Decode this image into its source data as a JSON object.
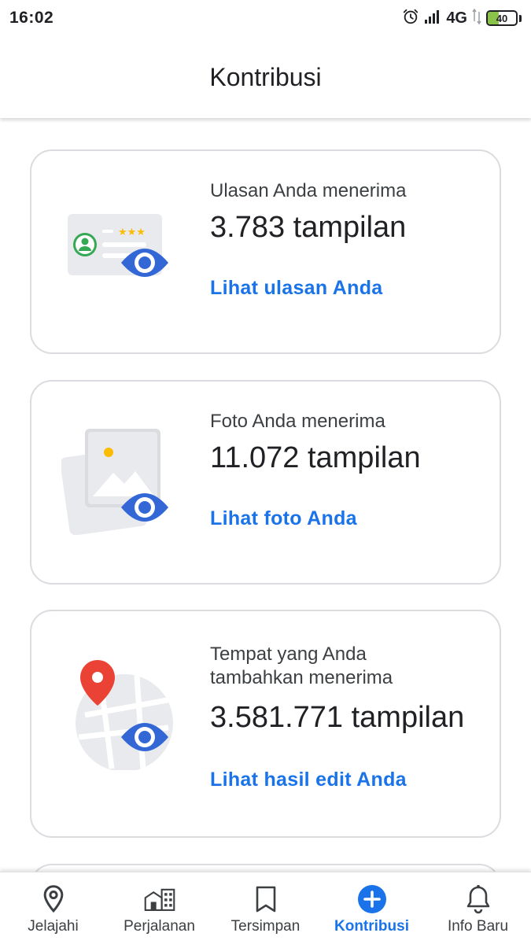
{
  "status_bar": {
    "time": "16:02",
    "network": "4G",
    "battery_level": "40",
    "battery_fill_percent": 40,
    "icons": [
      "alarm-icon",
      "signal-icon",
      "data-arrows-icon",
      "battery-icon"
    ]
  },
  "header": {
    "title": "Kontribusi"
  },
  "cards": [
    {
      "label": "Ulasan Anda menerima",
      "value": "3.783 tampilan",
      "link": "Lihat ulasan Anda",
      "icon": "review-eye-icon"
    },
    {
      "label": "Foto Anda menerima",
      "value": "11.072 tampilan",
      "link": "Lihat foto Anda",
      "icon": "photo-eye-icon"
    },
    {
      "label": "Tempat yang Anda tambahkan menerima",
      "value": "3.581.771 tampilan",
      "link": "Lihat hasil edit Anda",
      "icon": "map-eye-icon"
    }
  ],
  "bottom_nav": {
    "items": [
      {
        "label": "Jelajahi",
        "icon": "location-pin-icon",
        "active": false
      },
      {
        "label": "Perjalanan",
        "icon": "city-buildings-icon",
        "active": false
      },
      {
        "label": "Tersimpan",
        "icon": "bookmark-icon",
        "active": false
      },
      {
        "label": "Kontribusi",
        "icon": "add-circle-icon",
        "active": true
      },
      {
        "label": "Info Baru",
        "icon": "bell-icon",
        "active": false
      }
    ]
  },
  "colors": {
    "accent": "#1a73e8",
    "eye_blue": "#3367d6",
    "pin_red": "#ea4335",
    "star_yellow": "#fbbc04",
    "avatar_green": "#34a853",
    "illustration_gray": "#e8eaed",
    "border": "#dadce0"
  }
}
